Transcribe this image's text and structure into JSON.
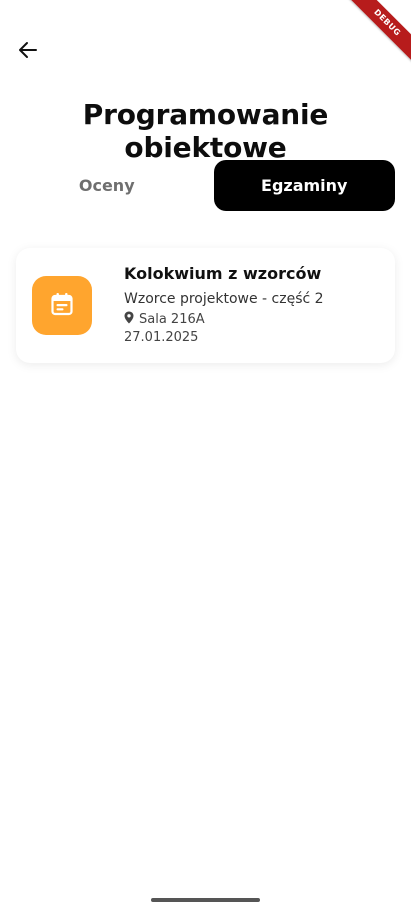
{
  "debug_banner": {
    "label": "DEBUG"
  },
  "header": {
    "back_icon": "arrow-left-icon",
    "title": "Programowanie obiektowe"
  },
  "tabs": [
    {
      "label": "Oceny",
      "active": false
    },
    {
      "label": "Egzaminy",
      "active": true
    }
  ],
  "exams": [
    {
      "icon": "calendar-event-icon",
      "icon_bg_color": "#ffa52e",
      "title": "Kolokwium z wzorców",
      "subtitle": "Wzorce projektowe - część 2",
      "location_icon": "location-pin-icon",
      "location": "Sala 216A",
      "date": "27.01.2025"
    }
  ],
  "colors": {
    "accent": "#ffa52e",
    "active_tab_bg": "#000000",
    "active_tab_text": "#ffffff",
    "inactive_tab_text": "#6f6f6f",
    "debug_ribbon": "#b71c1c"
  }
}
